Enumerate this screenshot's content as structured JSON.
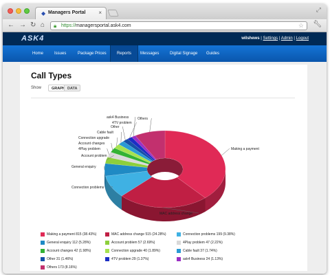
{
  "browser": {
    "tab_title": "Managers Portal",
    "url_scheme": "https://",
    "url_host": "managersportal.ask4.com"
  },
  "site": {
    "logo": "ASK4",
    "username": "wilshews",
    "links": [
      "Settings",
      "Admin",
      "Logout"
    ],
    "sep": "|",
    "nav": [
      "Home",
      "Issues",
      "Package Prices",
      "Reports",
      "Messages",
      "Digital Signage",
      "Guides"
    ],
    "active_nav": "Reports"
  },
  "page": {
    "title": "Call Types",
    "show_label": "Show",
    "toggle_graph": "GRAPH",
    "toggle_data": "DATA"
  },
  "chart_data": {
    "type": "pie",
    "style": "3d-donut",
    "series": [
      {
        "label": "Making a payment",
        "legend": "Making a payment 815 (38.43%)",
        "value": 815,
        "percent": 38.43,
        "color": "#e02a56"
      },
      {
        "label": "MAC address change",
        "legend": "MAC address change 515 (24.28%)",
        "value": 515,
        "percent": 24.28,
        "color": "#c01f44"
      },
      {
        "label": "Connection problems",
        "legend": "Connection problems 199 (9.38%)",
        "value": 199,
        "percent": 9.38,
        "color": "#3fb1e3"
      },
      {
        "label": "General enquiry",
        "legend": "General enquiry 112 (5.28%)",
        "value": 112,
        "percent": 5.28,
        "color": "#1f8ac4"
      },
      {
        "label": "Account problem",
        "legend": "Account problem 57 (2.69%)",
        "value": 57,
        "percent": 2.69,
        "color": "#8dcf3c"
      },
      {
        "label": "4Play problem",
        "legend": "4Play problem 47 (2.22%)",
        "value": 47,
        "percent": 2.22,
        "color": "#d9d9d9"
      },
      {
        "label": "Account changes",
        "legend": "Account changes 42 (1.98%)",
        "value": 42,
        "percent": 1.98,
        "color": "#33b233"
      },
      {
        "label": "Connection upgrade",
        "legend": "Connection upgrade 40 (1.89%)",
        "value": 40,
        "percent": 1.89,
        "color": "#a6e34f"
      },
      {
        "label": "Cable fault",
        "legend": "Cable fault 37 (1.74%)",
        "value": 37,
        "percent": 1.74,
        "color": "#2a9ad4"
      },
      {
        "label": "Other",
        "legend": "Other 31 (1.46%)",
        "value": 31,
        "percent": 1.46,
        "color": "#1650a8"
      },
      {
        "label": "4TV problem",
        "legend": "4TV problem 29 (1.37%)",
        "value": 29,
        "percent": 1.37,
        "color": "#1c2ec4"
      },
      {
        "label": "ask4 Business",
        "legend": "ask4 Business 24 (1.13%)",
        "value": 24,
        "percent": 1.13,
        "color": "#9b2fc4"
      },
      {
        "label": "Others",
        "legend": "Others 173 (8.16%)",
        "value": 173,
        "percent": 8.16,
        "color": "#c2306e"
      }
    ]
  }
}
